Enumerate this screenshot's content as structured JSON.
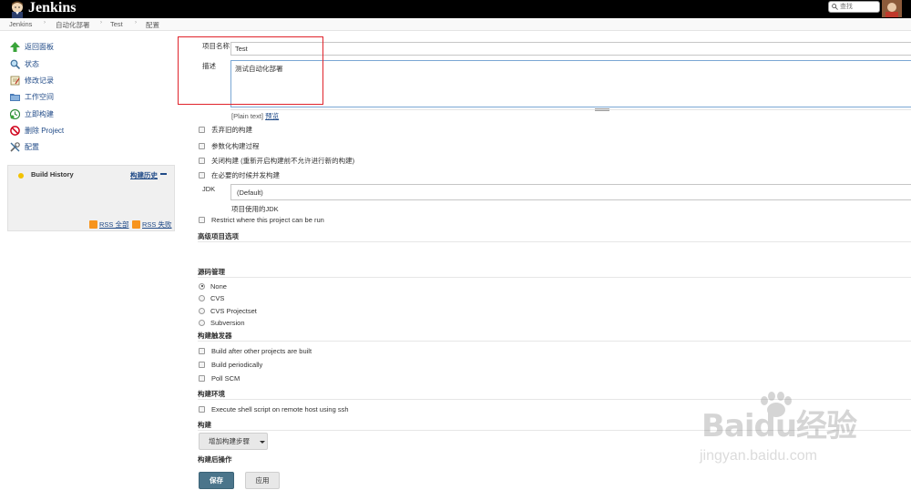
{
  "header": {
    "app_name": "Jenkins",
    "search_placeholder": "查找"
  },
  "breadcrumb": [
    "Jenkins",
    "自动化部署",
    "Test",
    "配置"
  ],
  "sidebar": {
    "items": [
      {
        "label": "返回面板",
        "icon": "up-arrow-icon"
      },
      {
        "label": "状态",
        "icon": "search-icon"
      },
      {
        "label": "修改记录",
        "icon": "notepad-icon"
      },
      {
        "label": "工作空间",
        "icon": "folder-icon"
      },
      {
        "label": "立即构建",
        "icon": "clock-icon"
      },
      {
        "label": "删除 Project",
        "icon": "no-entry-icon"
      },
      {
        "label": "配置",
        "icon": "tools-icon"
      }
    ],
    "build_history": {
      "title": "Build History",
      "trend_label": "构建历史",
      "rss_all": "RSS 全部",
      "rss_failures": "RSS 失败"
    }
  },
  "form": {
    "name_label": "项目名称",
    "name_value": "Test",
    "desc_label": "描述",
    "desc_value": "测试自动化部署",
    "plain_text": "[Plain text]",
    "preview": "预览",
    "options": [
      "丢弃旧的构建",
      "参数化构建过程",
      "关闭构建 (重新开启构建前不允许进行新的构建)",
      "在必要的时候并发构建"
    ],
    "jdk_label": "JDK",
    "jdk_value": "(Default)",
    "jdk_help": "项目使用的JDK",
    "restrict_label": "Restrict where this project can be run",
    "advanced_section": "高级项目选项",
    "scm_section": "源码管理",
    "scm_options": [
      {
        "label": "None",
        "checked": true
      },
      {
        "label": "CVS",
        "checked": false
      },
      {
        "label": "CVS Projectset",
        "checked": false
      },
      {
        "label": "Subversion",
        "checked": false
      }
    ],
    "triggers_section": "构建触发器",
    "triggers": [
      "Build after other projects are built",
      "Build periodically",
      "Poll SCM"
    ],
    "env_section": "构建环境",
    "env_options": [
      "Execute shell script on remote host using ssh"
    ],
    "build_section": "构建",
    "add_step": "增加构建步骤",
    "post_build_section": "构建后操作",
    "save": "保存",
    "apply": "应用"
  },
  "colors": {
    "header_bg": "#000000",
    "link": "#204a87",
    "save_button": "#4b758b",
    "highlight": "#e0232b"
  },
  "watermark": {
    "brand": "Baidu经验",
    "url": "jingyan.baidu.com"
  }
}
